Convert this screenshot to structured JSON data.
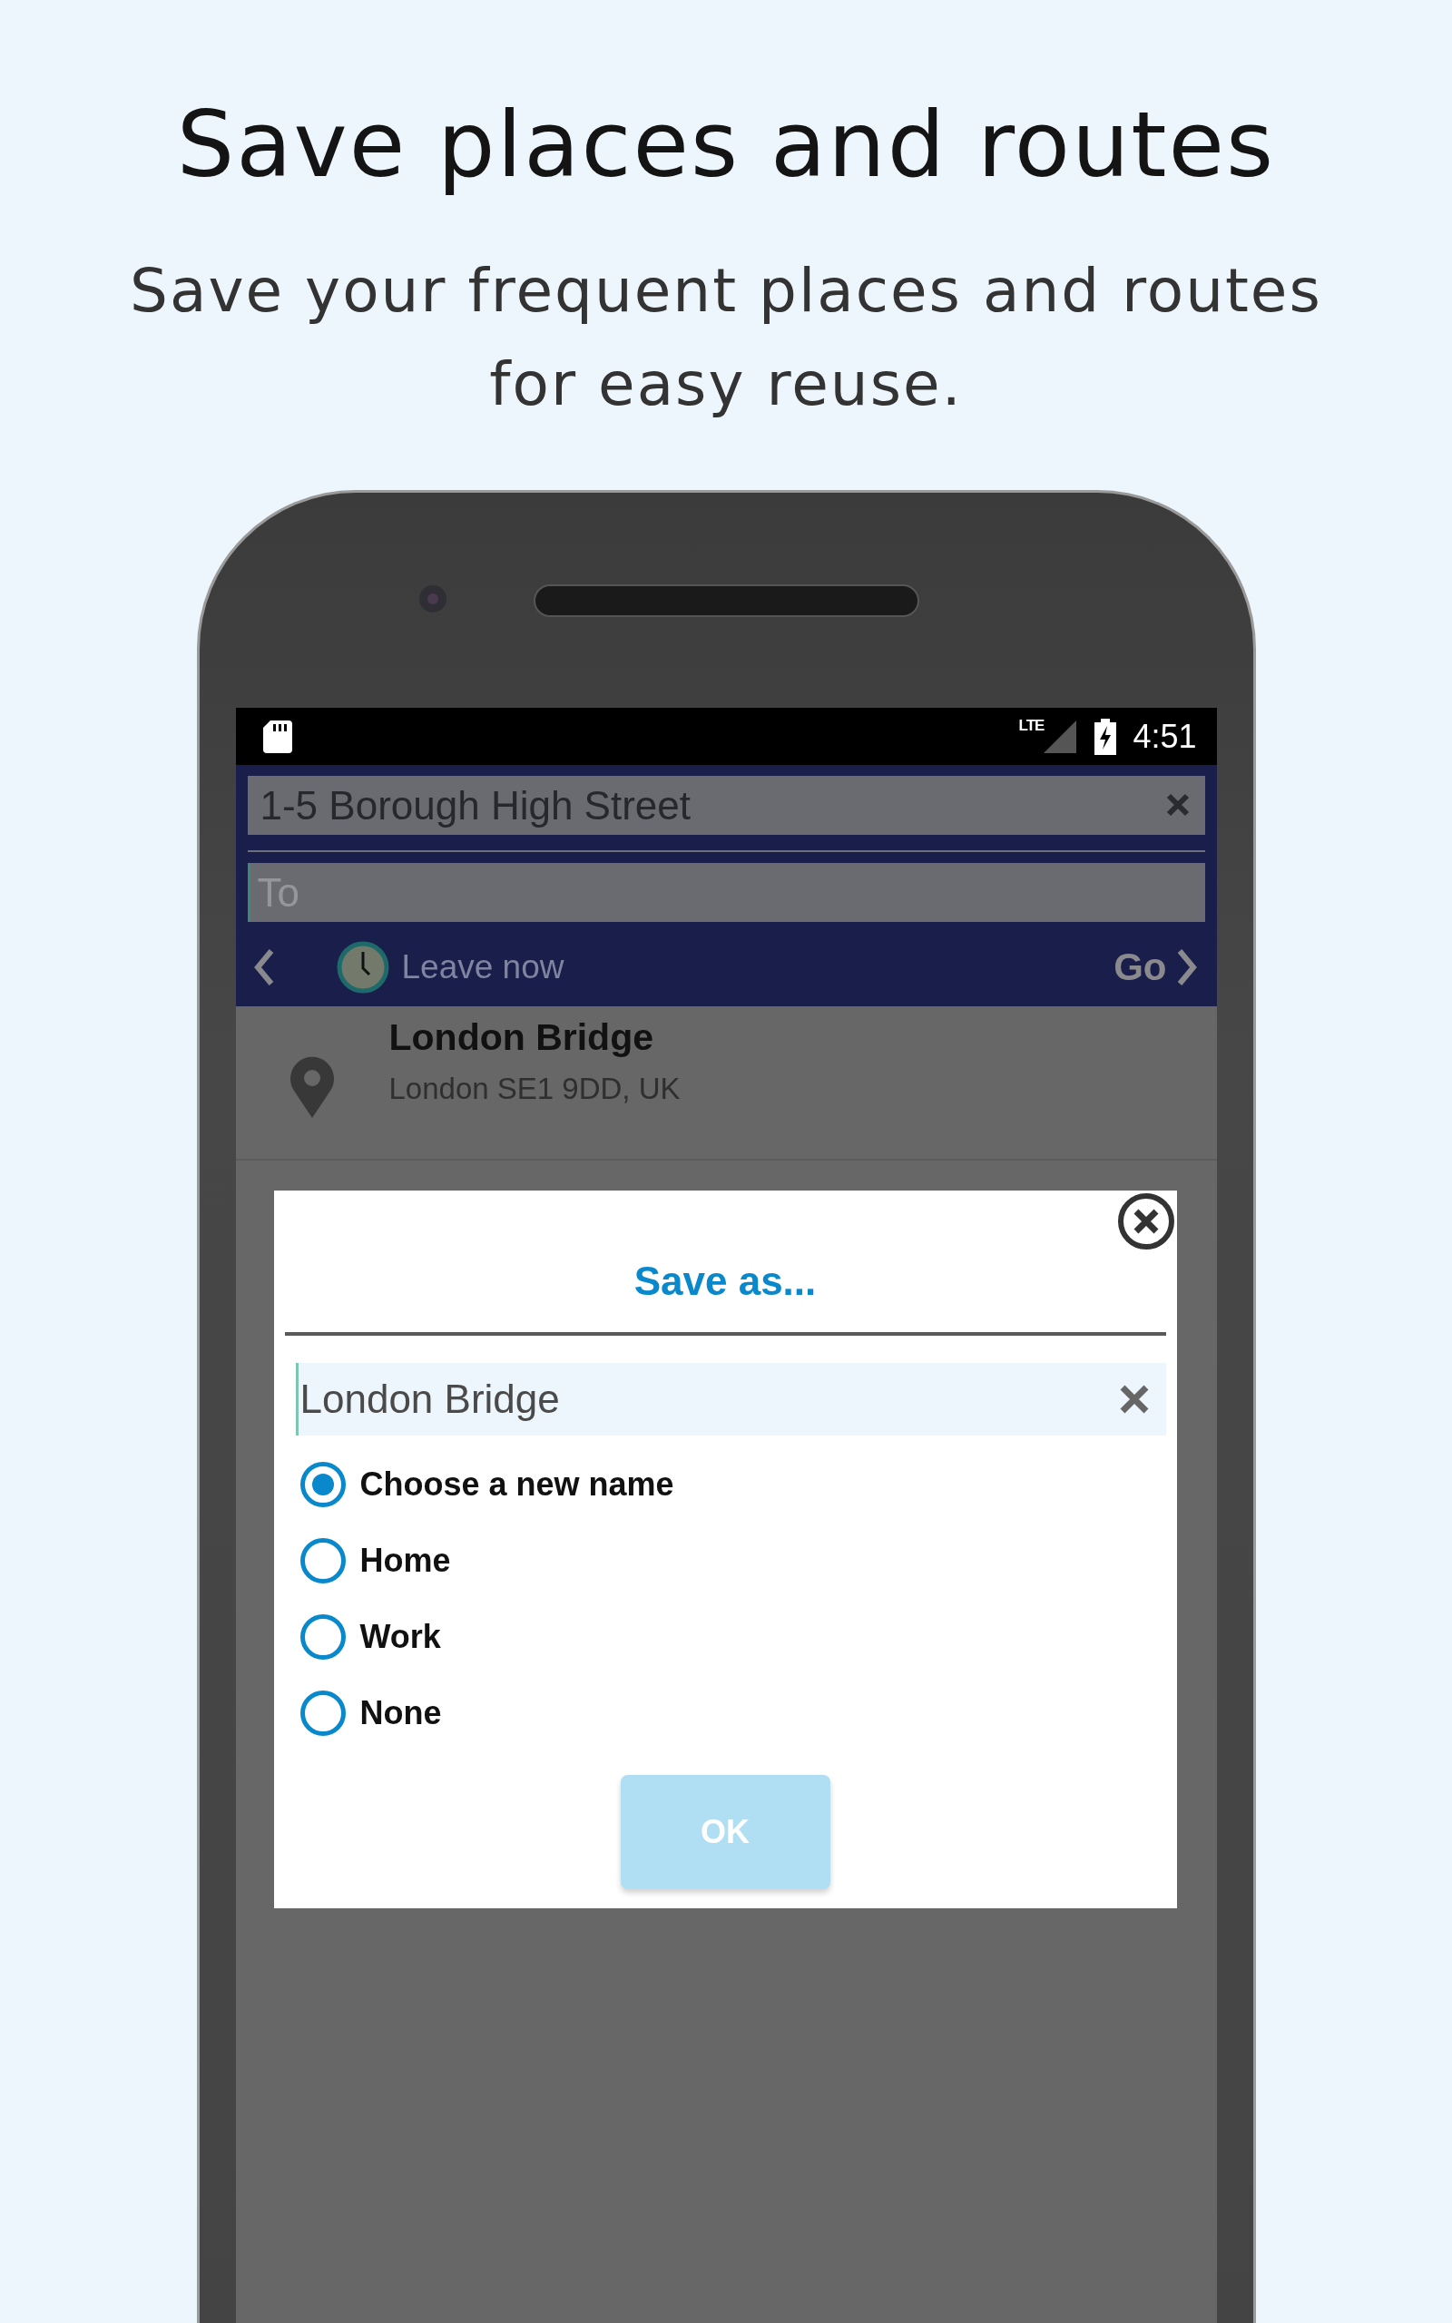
{
  "heading": {
    "title": "Save places and routes",
    "subtitle": "Save your frequent places and routes for easy reuse."
  },
  "status_bar": {
    "network": "LTE",
    "time": "4:51"
  },
  "route": {
    "from_value": "1-5 Borough High Street",
    "to_placeholder": "To",
    "time_label": "Leave now",
    "go_label": "Go"
  },
  "results": [
    {
      "name": "London Bridge",
      "address": "London SE1 9DD, UK"
    }
  ],
  "dialog": {
    "title": "Save as...",
    "name_value": "London Bridge",
    "options": [
      {
        "label": "Choose a new name",
        "selected": true
      },
      {
        "label": "Home",
        "selected": false
      },
      {
        "label": "Work",
        "selected": false
      },
      {
        "label": "None",
        "selected": false
      }
    ],
    "ok": {
      "label": "OK",
      "disabled": true
    }
  }
}
